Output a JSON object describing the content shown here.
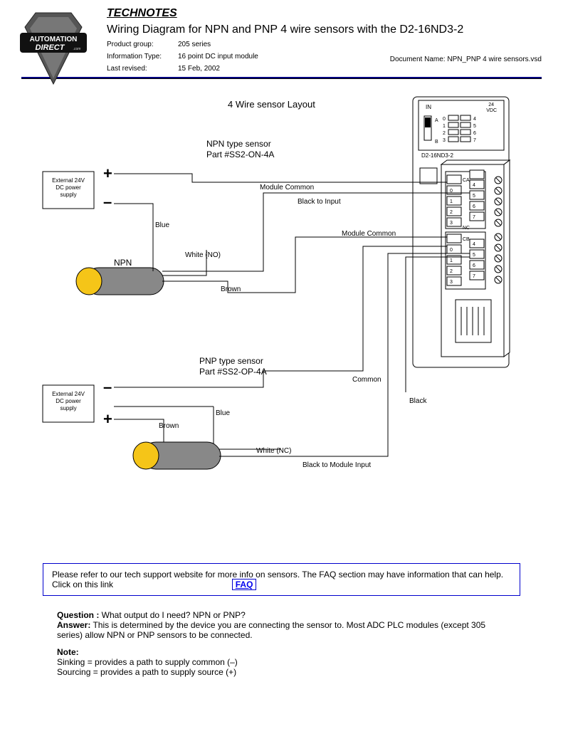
{
  "header": {
    "technotes": "TECHNOTES",
    "title": "Wiring Diagram for NPN and PNP 4 wire sensors with the D2-16ND3-2",
    "product_group_label": "Product group:",
    "product_group": "205 series",
    "info_type_label": "Information Type:",
    "info_type": "16 point DC input module",
    "last_revised_label": "Last revised:",
    "last_revised": "15 Feb, 2002",
    "docname_label": "Document Name:",
    "docname": "NPN_PNP 4 wire sensors.vsd"
  },
  "diagram": {
    "layout_title": "4 Wire sensor Layout",
    "npn_title_1": "NPN type sensor",
    "npn_title_2": "Part #SS2-ON-4A",
    "pnp_title_1": "PNP type sensor",
    "pnp_title_2": "Part #SS2-OP-4A",
    "psu_line1": "External 24V",
    "psu_line2": "DC power",
    "psu_line3": "supply",
    "plus": "+",
    "minus": "–",
    "npn_label": "NPN",
    "wire_blue": "Blue",
    "wire_white_no": "White (NO)",
    "wire_brown": "Brown",
    "wire_white_nc": "White (NC)",
    "wire_black": "Black",
    "wire_black_input": "Black to Input",
    "wire_black_modinput": "Black to Module Input",
    "module_common": "Module Common",
    "common": "Common",
    "module_in": "IN",
    "module_24vdc_1": "24",
    "module_24vdc_2": "VDC",
    "module_a": "A",
    "module_b": "B",
    "module_name": "D2-16ND3-2",
    "terminals_ca": "CA",
    "terminals_nc": "NC",
    "terminals_cb": "CB",
    "t0": "0",
    "t1": "1",
    "t2": "2",
    "t3": "3",
    "t4": "4",
    "t5": "5",
    "t6": "6",
    "t7": "7"
  },
  "faq": {
    "text1": "Please refer to our tech support website for more info on sensors.  The FAQ section may have information that can help.  Click on this link",
    "link": "FAQ"
  },
  "qa": {
    "q_label": "Question :",
    "q": " What output do I need? NPN or PNP?",
    "a_label": "Answer:",
    "a": " This is determined by the device you are connecting the sensor to. Most ADC PLC modules (except 305 series) allow NPN or PNP sensors to be connected."
  },
  "note": {
    "label": "Note:",
    "line1": "Sinking = provides a path to supply common (–)",
    "line2": "Sourcing = provides a path to supply source (+)"
  }
}
